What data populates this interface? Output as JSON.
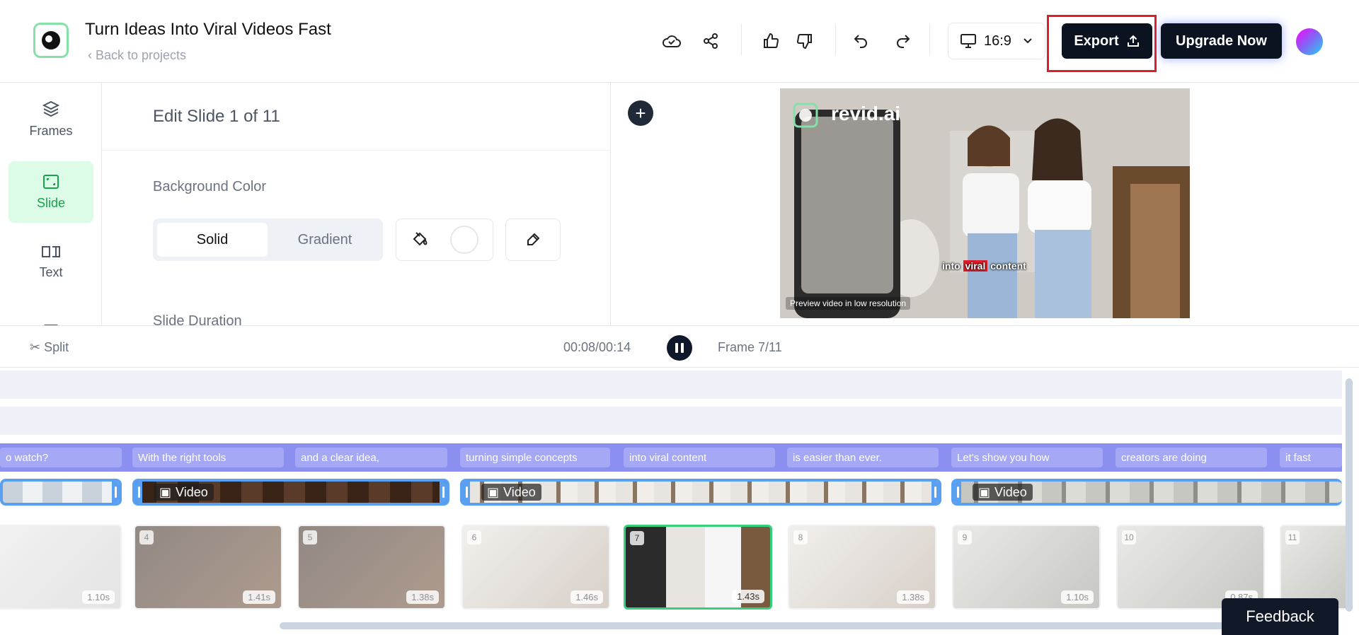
{
  "header": {
    "title": "Turn Ideas Into Viral Videos Fast",
    "back_label": "Back to projects",
    "ratio": "16:9",
    "export_label": "Export",
    "upgrade_label": "Upgrade Now"
  },
  "sidebar": {
    "items": [
      {
        "label": "Frames",
        "icon": "layers-icon"
      },
      {
        "label": "Slide",
        "icon": "slide-icon"
      },
      {
        "label": "Text",
        "icon": "text-icon"
      },
      {
        "label": "",
        "icon": "image-icon"
      }
    ]
  },
  "panel": {
    "title": "Edit Slide 1 of 11",
    "bg_label": "Background Color",
    "solid": "Solid",
    "gradient": "Gradient",
    "duration_label": "Slide Duration"
  },
  "preview": {
    "watermark": "revid.ai",
    "caption_pre": "into",
    "caption_hl": "viral",
    "caption_post": "content",
    "lowres_note": "Preview video in low resolution"
  },
  "controls": {
    "split": "Split",
    "time": "00:08/00:14",
    "frame": "Frame 7/11"
  },
  "subtitles": [
    "o watch?",
    "With the right tools",
    "and a clear idea,",
    "turning simple concepts",
    "into viral content",
    "is easier than ever.",
    "Let's show you how",
    "creators are doing",
    "it fast"
  ],
  "video_clips": [
    "Video",
    "Video",
    "Video"
  ],
  "thumbs": [
    {
      "num": "",
      "dur": "1.10s"
    },
    {
      "num": "4",
      "dur": "1.41s"
    },
    {
      "num": "5",
      "dur": "1.38s"
    },
    {
      "num": "6",
      "dur": "1.46s"
    },
    {
      "num": "7",
      "dur": "1.43s"
    },
    {
      "num": "8",
      "dur": "1.38s"
    },
    {
      "num": "9",
      "dur": "1.10s"
    },
    {
      "num": "10",
      "dur": "0.87s"
    },
    {
      "num": "11",
      "dur": ""
    }
  ],
  "feedback": "Feedback"
}
